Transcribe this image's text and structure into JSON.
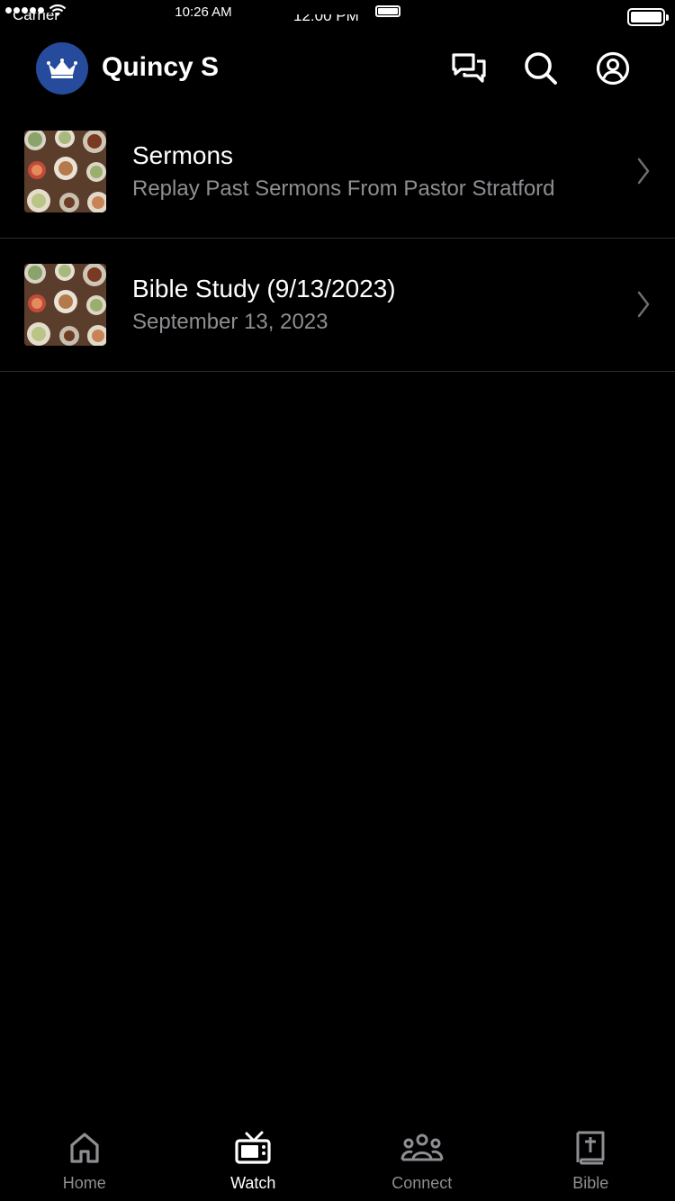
{
  "status_bar": {
    "time": "10:26 AM",
    "carrier_ghost": "Carrier",
    "time_ghost": "12:00 PM"
  },
  "header": {
    "user_name": "Quincy S",
    "avatar_icon": "crown-icon",
    "avatar_color": "#274b9c",
    "actions": [
      "chat-icon",
      "search-icon",
      "profile-icon"
    ]
  },
  "list": {
    "items": [
      {
        "title": "Sermons",
        "subtitle": "Replay Past Sermons From Pastor Stratford"
      },
      {
        "title": "Bible Study (9/13/2023)",
        "subtitle": "September 13, 2023"
      }
    ]
  },
  "tab_bar": {
    "tabs": [
      {
        "label": "Home",
        "icon": "home-icon"
      },
      {
        "label": "Watch",
        "icon": "tv-icon",
        "active": true
      },
      {
        "label": "Connect",
        "icon": "people-icon"
      },
      {
        "label": "Bible",
        "icon": "bible-icon"
      }
    ]
  },
  "colors": {
    "background": "#000000",
    "subtitle": "#8e8e93",
    "divider": "#2c2c2e"
  }
}
